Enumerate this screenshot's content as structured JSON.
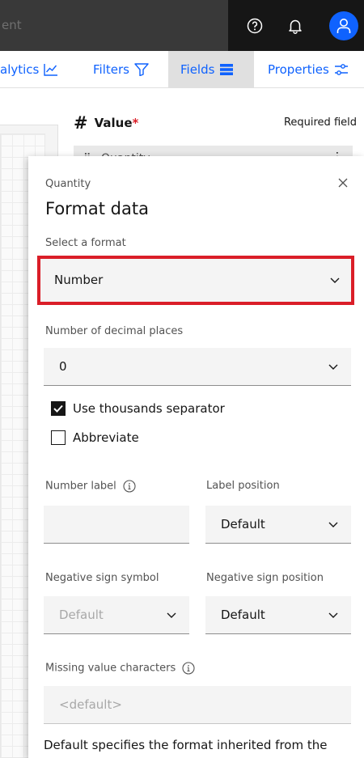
{
  "topbar": {
    "search_placeholder": "ent",
    "help_icon": "help-icon",
    "notification_icon": "bell-icon",
    "user_icon": "user-avatar-icon"
  },
  "tabs": [
    {
      "label": "alytics",
      "icon": "line-chart-icon"
    },
    {
      "label": "Filters",
      "icon": "filter-icon"
    },
    {
      "label": "Fields",
      "icon": "fields-list-icon",
      "selected": true
    },
    {
      "label": "Properties",
      "icon": "sliders-icon"
    }
  ],
  "fields_panel": {
    "value_label": "Value",
    "required_mark": "*",
    "required_text": "Required field",
    "chip_text": "Quantity"
  },
  "popover": {
    "subtitle": "Quantity",
    "title": "Format data",
    "close_icon": "close-icon",
    "format_label": "Select a format",
    "format_value": "Number",
    "decimal_label": "Number of decimal places",
    "decimal_value": "0",
    "thousands_label": "Use thousands separator",
    "thousands_checked": true,
    "abbreviate_label": "Abbreviate",
    "abbreviate_checked": false,
    "number_label_label": "Number label",
    "number_label_value": "",
    "label_position_label": "Label position",
    "label_position_value": "Default",
    "neg_symbol_label": "Negative sign symbol",
    "neg_symbol_value": "Default",
    "neg_position_label": "Negative sign position",
    "neg_position_value": "Default",
    "missing_label": "Missing value characters",
    "missing_placeholder": "<default>",
    "helper_text": "Default specifies the format inherited from the system."
  },
  "colors": {
    "accent": "#0f62fe",
    "highlight_border": "#da1e28",
    "topbar": "#161616"
  }
}
